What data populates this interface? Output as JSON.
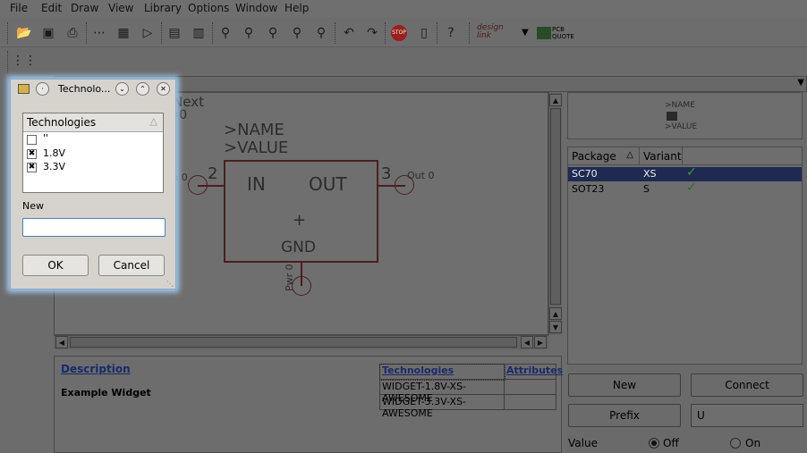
{
  "menubar": {
    "items": [
      "File",
      "Edit",
      "Draw",
      "View",
      "Library",
      "Options",
      "Window",
      "Help"
    ]
  },
  "toolbar": {
    "icons": [
      "open-icon",
      "save-icon",
      "print-icon",
      "cam-icon",
      "ulp-icon",
      "script-icon",
      "export-icon",
      "run-icon",
      "zoom-fit-icon",
      "zoom-in-icon",
      "zoom-out-icon",
      "zoom-redraw-icon",
      "zoom-select-icon",
      "undo-icon",
      "redo-icon",
      "stop-icon",
      "go-icon",
      "help-icon",
      "designlink-icon",
      "pcb-quote-icon"
    ],
    "designlink_label": "design link",
    "pcbquote_label": "PCB QUOTE"
  },
  "canvas": {
    "hint_line1": "d=Next",
    "hint_line2": "ap=0",
    "name_label": ">NAME",
    "value_label": ">VALUE",
    "pin_in": "IN",
    "pin_out": "OUT",
    "pin_gnd": "GND",
    "pin2": "2",
    "pin3": "3",
    "pin_in_name": "In 0",
    "pin_out_name": "Out 0",
    "pin_pwr_name": "Pwr 0"
  },
  "description": {
    "link": "Description",
    "text": "Example Widget"
  },
  "tech_table": {
    "headers": [
      "Technologies",
      "Attributes"
    ],
    "rows": [
      "WIDGET-1.8V-XS-AWESOME",
      "WIDGET-3.3V-XS-AWESOME"
    ]
  },
  "preview": {
    "name": ">NAME",
    "value": ">VALUE"
  },
  "packages": {
    "headers": [
      "Package",
      "Variant"
    ],
    "rows": [
      {
        "package": "SC70",
        "variant": "XS",
        "selected": true
      },
      {
        "package": "SOT23",
        "variant": "S",
        "selected": false
      }
    ]
  },
  "buttons": {
    "new": "New",
    "connect": "Connect",
    "prefix": "Prefix",
    "prefix_value": "U"
  },
  "value_row": {
    "label": "Value",
    "off": "Off",
    "on": "On"
  },
  "dialog": {
    "title": "Technolo...",
    "list_header": "Technologies",
    "items": [
      {
        "label": "''",
        "checked": false
      },
      {
        "label": "1.8V",
        "checked": true
      },
      {
        "label": "3.3V",
        "checked": true
      }
    ],
    "new_label": "New",
    "new_value": "",
    "ok": "OK",
    "cancel": "Cancel"
  },
  "colors": {
    "selection": "#1e2a52",
    "dialog_glow": "#9fd0f5",
    "symbol": "#4a2020"
  }
}
